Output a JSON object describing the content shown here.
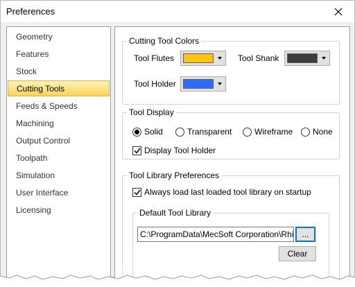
{
  "window": {
    "title": "Preferences"
  },
  "nav": {
    "items": [
      {
        "label": "Geometry"
      },
      {
        "label": "Features"
      },
      {
        "label": "Stock"
      },
      {
        "label": "Cutting Tools"
      },
      {
        "label": "Feeds & Speeds"
      },
      {
        "label": "Machining"
      },
      {
        "label": "Output Control"
      },
      {
        "label": "Toolpath"
      },
      {
        "label": "Simulation"
      },
      {
        "label": "User Interface"
      },
      {
        "label": "Licensing"
      }
    ],
    "selected": "Cutting Tools"
  },
  "colors_group": {
    "title": "Cutting Tool Colors",
    "tool_flutes_label": "Tool Flutes",
    "tool_flutes_color": "#ffc20e",
    "tool_shank_label": "Tool Shank",
    "tool_shank_color": "#3c3c3c",
    "tool_holder_label": "Tool Holder",
    "tool_holder_color": "#2f6bff"
  },
  "display_group": {
    "title": "Tool Display",
    "options": [
      {
        "label": "Solid",
        "checked": true
      },
      {
        "label": "Transparent",
        "checked": false
      },
      {
        "label": "Wireframe",
        "checked": false
      },
      {
        "label": "None",
        "checked": false
      }
    ],
    "display_holder_label": "Display Tool Holder",
    "display_holder_checked": true
  },
  "library_group": {
    "title": "Tool Library Preferences",
    "always_load_label": "Always load last loaded tool library on startup",
    "always_load_checked": true,
    "default_title": "Default Tool Library",
    "path_value": "C:\\ProgramData\\MecSoft Corporation\\RhinoCAM",
    "browse_label": "...",
    "clear_label": "Clear"
  },
  "theme": {
    "accent": "#0078d7",
    "selected_bg": "#fbd55c",
    "selected_border": "#e2b234"
  }
}
